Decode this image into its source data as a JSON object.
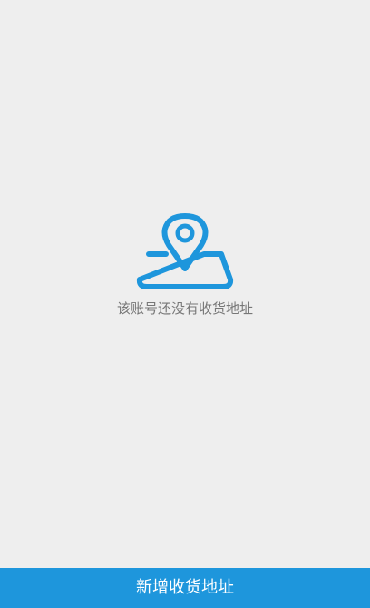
{
  "empty_state": {
    "icon": "map-location-pin-icon",
    "message": "该账号还没有收货地址",
    "accent_color": "#1e96dc"
  },
  "footer": {
    "add_address_label": "新增收货地址",
    "button_color": "#1e96dc"
  }
}
